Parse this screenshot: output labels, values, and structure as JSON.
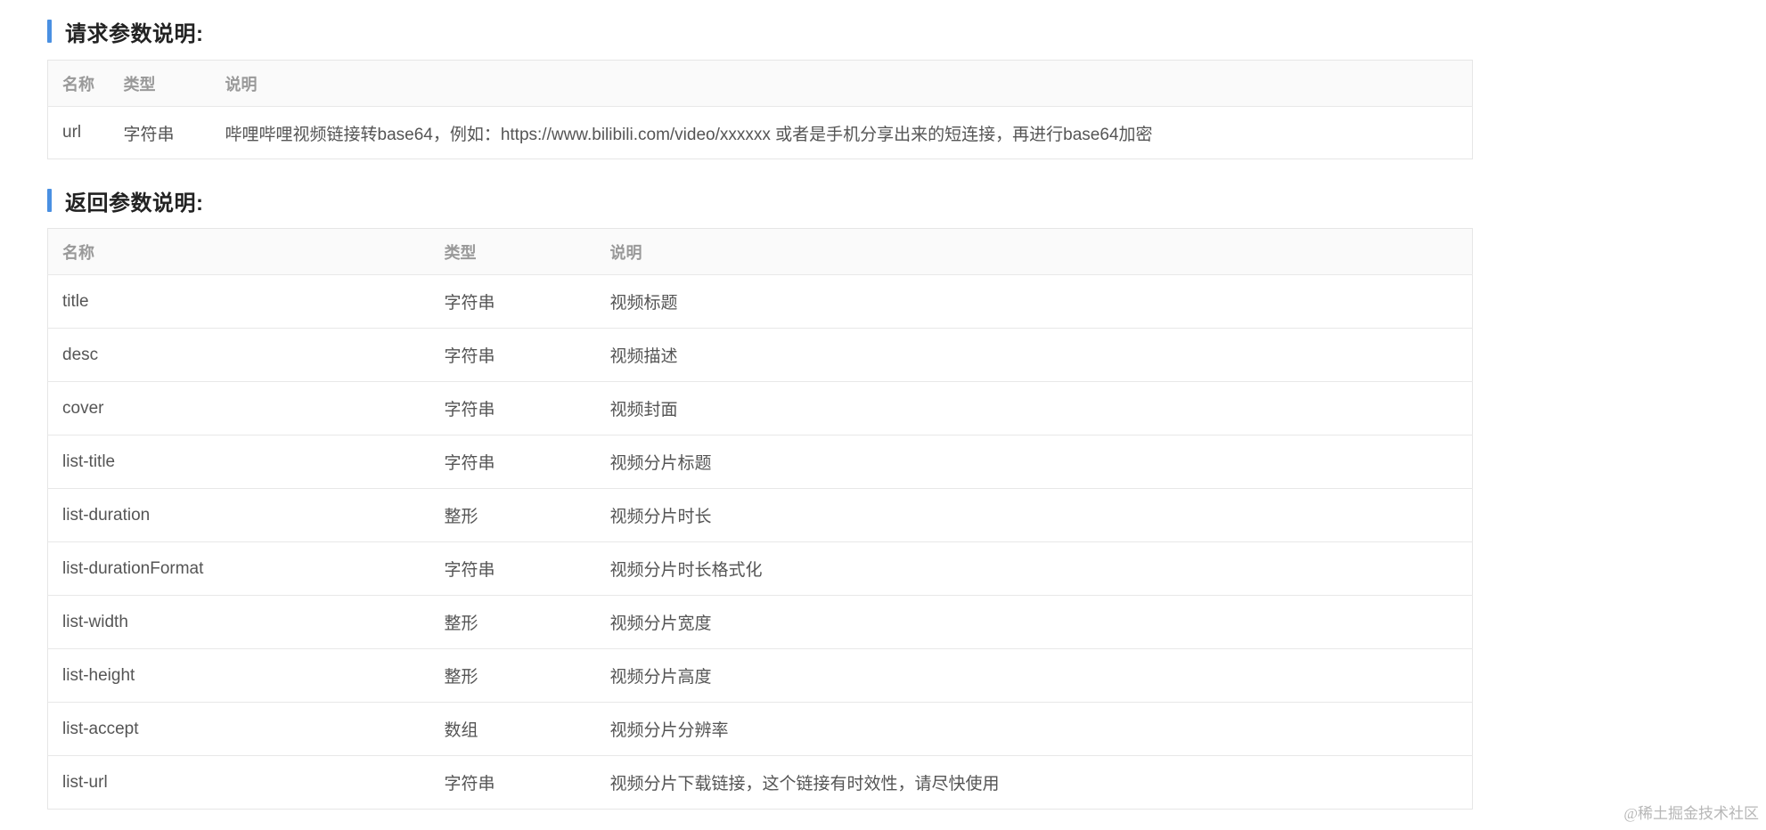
{
  "request": {
    "title": "请求参数说明:",
    "headers": {
      "name": "名称",
      "type": "类型",
      "desc": "说明"
    },
    "rows": [
      {
        "name": "url",
        "type": "字符串",
        "desc": "哔哩哔哩视频链接转base64，例如：https://www.bilibili.com/video/xxxxxx 或者是手机分享出来的短连接，再进行base64加密"
      }
    ]
  },
  "response": {
    "title": "返回参数说明:",
    "headers": {
      "name": "名称",
      "type": "类型",
      "desc": "说明"
    },
    "rows": [
      {
        "name": "title",
        "type": "字符串",
        "desc": "视频标题"
      },
      {
        "name": "desc",
        "type": "字符串",
        "desc": "视频描述"
      },
      {
        "name": "cover",
        "type": "字符串",
        "desc": "视频封面"
      },
      {
        "name": "list-title",
        "type": "字符串",
        "desc": "视频分片标题"
      },
      {
        "name": "list-duration",
        "type": "整形",
        "desc": "视频分片时长"
      },
      {
        "name": "list-durationFormat",
        "type": "字符串",
        "desc": "视频分片时长格式化"
      },
      {
        "name": "list-width",
        "type": "整形",
        "desc": "视频分片宽度"
      },
      {
        "name": "list-height",
        "type": "整形",
        "desc": "视频分片高度"
      },
      {
        "name": "list-accept",
        "type": "数组",
        "desc": "视频分片分辨率"
      },
      {
        "name": "list-url",
        "type": "字符串",
        "desc": "视频分片下载链接，这个链接有时效性，请尽快使用"
      }
    ]
  },
  "watermark": "@稀土掘金技术社区",
  "colors": {
    "accent": "#4a90e2",
    "header_bg": "#fafafa",
    "border": "#e6e6e6"
  }
}
